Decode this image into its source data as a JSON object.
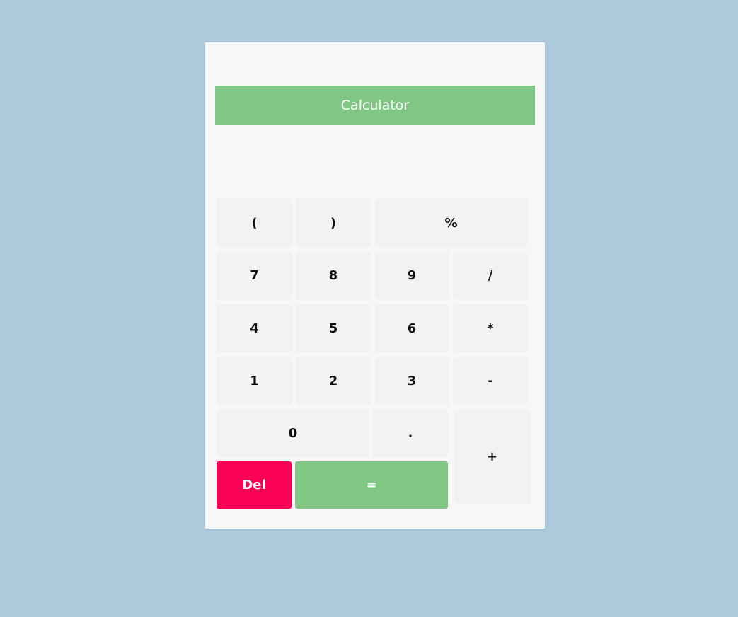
{
  "app": {
    "title": "Calculator",
    "display_value": ""
  },
  "keys": {
    "open_paren": "(",
    "close_paren": ")",
    "percent": "%",
    "seven": "7",
    "eight": "8",
    "nine": "9",
    "divide": "/",
    "four": "4",
    "five": "5",
    "six": "6",
    "multiply": "*",
    "one": "1",
    "two": "2",
    "three": "3",
    "minus": "-",
    "zero": "0",
    "decimal": ".",
    "plus": "+",
    "delete": "Del",
    "equals": "="
  },
  "colors": {
    "page_background": "#adc9dc",
    "card_background": "#f8f7f8",
    "accent_green": "#80c784",
    "delete_red": "#fa0056",
    "key_background": "#f2f2f2"
  }
}
